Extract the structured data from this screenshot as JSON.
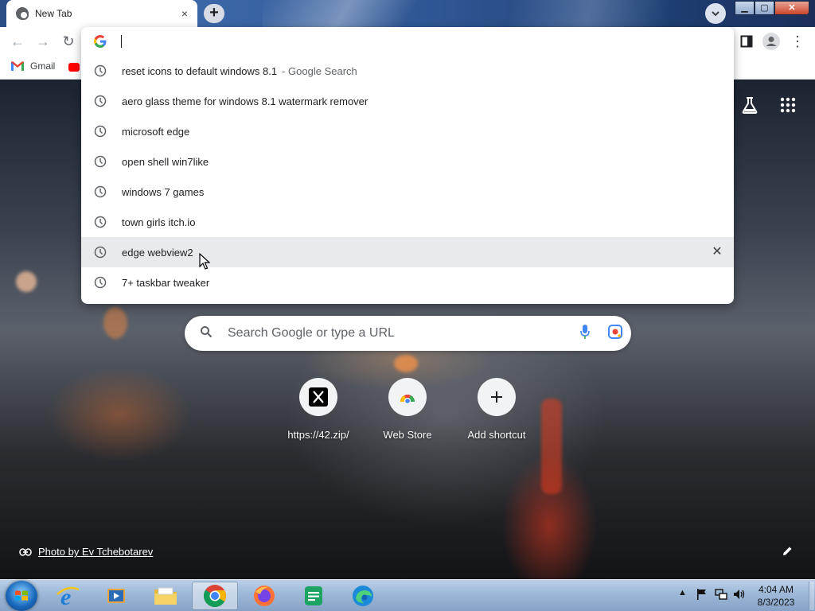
{
  "window": {
    "tab_title": "New Tab",
    "tab_close": "×",
    "new_tab": "+",
    "minimize": "▁",
    "maximize": "▢",
    "close": "✕"
  },
  "toolbar": {
    "back": "←",
    "forward": "→",
    "reload": "↻",
    "side_panel": "▣",
    "profile": "●",
    "menu": "⋮"
  },
  "bookmarks": [
    {
      "label": "Gmail",
      "icon": "gmail-icon"
    },
    {
      "label": "",
      "icon": "youtube-icon"
    }
  ],
  "omnibox": {
    "input_value": "",
    "suggestions": [
      {
        "text": "reset icons to default windows 8.1",
        "sub": "- Google Search"
      },
      {
        "text": "aero glass theme for windows 8.1 watermark remover",
        "sub": ""
      },
      {
        "text": "microsoft edge",
        "sub": ""
      },
      {
        "text": "open shell win7like",
        "sub": ""
      },
      {
        "text": "windows 7 games",
        "sub": ""
      },
      {
        "text": "town girls itch.io",
        "sub": ""
      },
      {
        "text": "edge webview2",
        "sub": "",
        "hovered": true
      },
      {
        "text": "7+ taskbar tweaker",
        "sub": ""
      }
    ],
    "remove_glyph": "✕"
  },
  "ntp": {
    "search_placeholder": "Search Google or type a URL",
    "shortcuts": [
      {
        "label": "https://42.zip/",
        "icon": "x-icon"
      },
      {
        "label": "Web Store",
        "icon": "web-store-icon"
      },
      {
        "label": "Add shortcut",
        "icon": "plus-icon"
      }
    ],
    "photo_credit": "Photo by Ev Tchebotarev"
  },
  "taskbar": {
    "apps": [
      "internet-explorer-icon",
      "media-player-icon",
      "file-explorer-icon",
      "chrome-icon",
      "firefox-icon",
      "sheets-icon",
      "edge-icon"
    ],
    "time": "4:04 AM",
    "date": "8/3/2023"
  }
}
